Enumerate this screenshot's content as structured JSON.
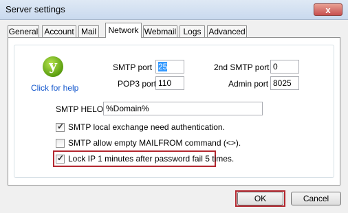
{
  "window": {
    "title": "Server settings",
    "close_glyph": "x"
  },
  "tabs": [
    {
      "label": "General"
    },
    {
      "label": "Account"
    },
    {
      "label": "Mail"
    },
    {
      "label": "Network",
      "active": true
    },
    {
      "label": "Webmail"
    },
    {
      "label": "Logs"
    },
    {
      "label": "Advanced"
    }
  ],
  "logo": {
    "glyph": "y",
    "icon": "help-logo-icon"
  },
  "help_link": "Click for help",
  "fields": {
    "smtp_port": {
      "label": "SMTP port",
      "value": "25"
    },
    "smtp_port2": {
      "label": "2nd SMTP port",
      "value": "0"
    },
    "pop3_port": {
      "label": "POP3 port",
      "value": "110"
    },
    "admin_port": {
      "label": "Admin port",
      "value": "8025"
    },
    "smtp_helo": {
      "label": "SMTP HELO",
      "value": "%Domain%"
    }
  },
  "checkboxes": {
    "auth": {
      "label": "SMTP local exchange need authentication.",
      "checked": true
    },
    "mailfrom": {
      "label": "SMTP allow empty MAILFROM command (<>).",
      "checked": false
    },
    "lock": {
      "label": "Lock IP 1 minutes after password fail 5 times.",
      "checked": true
    }
  },
  "buttons": {
    "ok": "OK",
    "cancel": "Cancel"
  },
  "colors": {
    "highlight": "#b3272f",
    "link": "#1155cc",
    "selection": "#3399ff"
  }
}
